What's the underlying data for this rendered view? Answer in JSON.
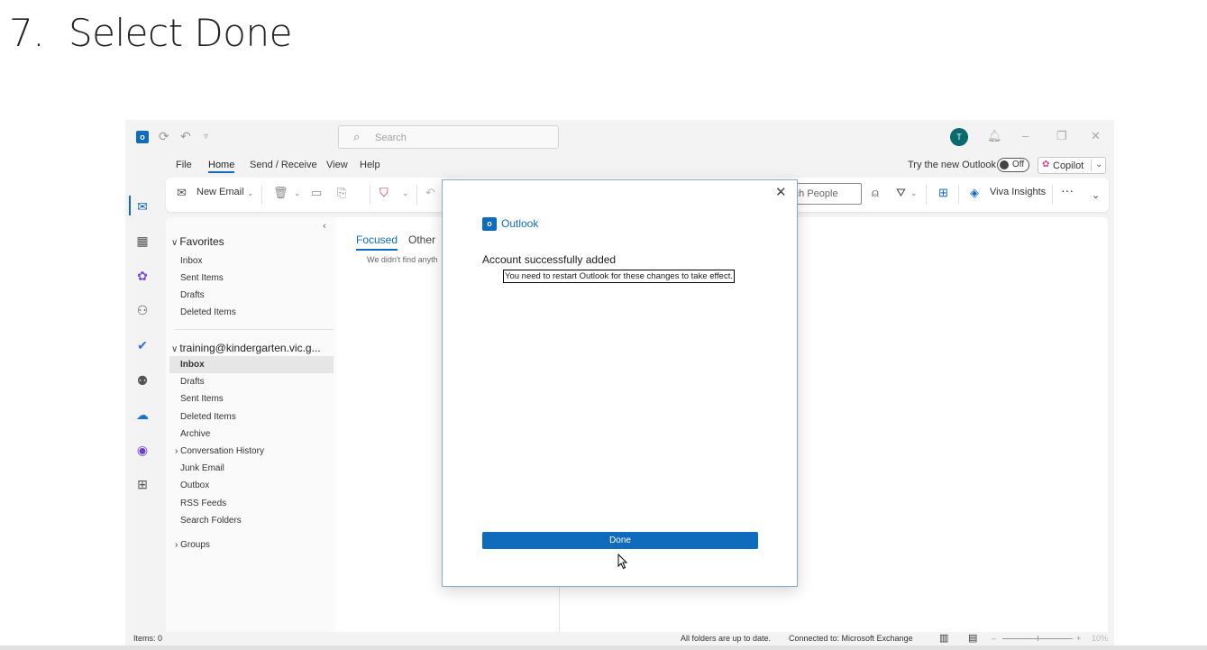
{
  "step": {
    "number": "7.",
    "title": "Select Done"
  },
  "titlebar": {
    "search_placeholder": "Search",
    "avatar_initial": "T"
  },
  "menu": {
    "tabs": [
      "File",
      "Home",
      "Send / Receive",
      "View",
      "Help"
    ],
    "active_tab": "Home",
    "try_new_outlook": "Try the new Outlook",
    "toggle_state": "Off",
    "copilot_label": "Copilot"
  },
  "ribbon": {
    "new_email": "New Email",
    "people_search": "rch People",
    "viva_insights": "Viva Insights",
    "more": "···"
  },
  "folders": {
    "favorites_header": "Favorites",
    "favorites": [
      "Inbox",
      "Sent Items",
      "Drafts",
      "Deleted Items"
    ],
    "account_header": "training@kindergarten.vic.g...",
    "account_items": [
      "Inbox",
      "Drafts",
      "Sent Items",
      "Deleted Items",
      "Archive",
      "Conversation History",
      "Junk Email",
      "Outbox",
      "RSS Feeds",
      "Search Folders"
    ],
    "groups_header": "Groups"
  },
  "message_list": {
    "focused_tab": "Focused",
    "other_tab": "Other",
    "empty_text": "We didn't find anyth"
  },
  "dialog": {
    "brand": "Outlook",
    "heading": "Account successfully added",
    "message": "You need to restart Outlook for these changes to take effect.",
    "done_label": "Done"
  },
  "status_bar": {
    "items": "Items: 0",
    "sync": "All folders are up to date.",
    "connection": "Connected to: Microsoft Exchange",
    "zoom": "10%"
  },
  "colors": {
    "accent": "#0f6cbd",
    "avatar": "#0b6a6e"
  }
}
